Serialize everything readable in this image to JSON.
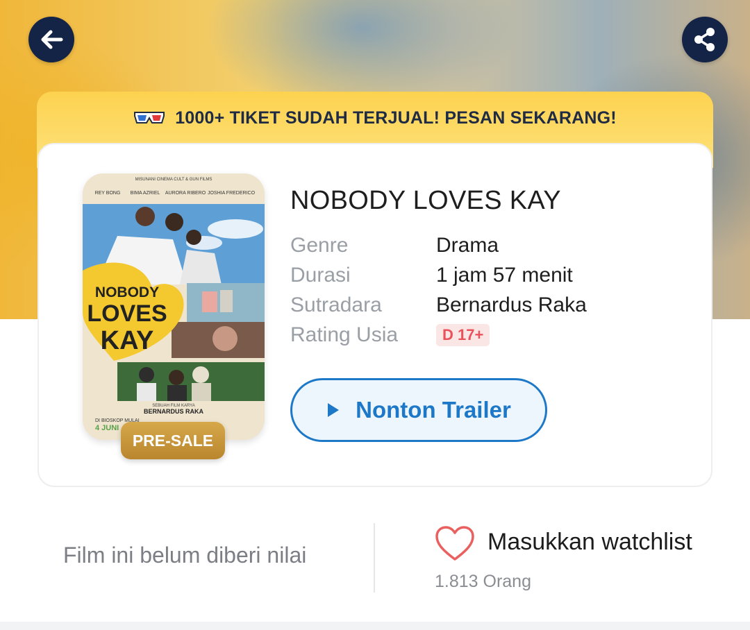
{
  "header": {
    "back_icon": "arrow-left-icon",
    "share_icon": "share-icon"
  },
  "banner": {
    "icon": "3d-glasses-icon",
    "text": "1000+ TIKET SUDAH TERJUAL! PESAN SEKARANG!"
  },
  "movie": {
    "title": "NOBODY LOVES KAY",
    "badge": "PRE-SALE",
    "poster": {
      "studio": "MISUNANI CINEMA CULT & GUN FILMS",
      "cast": [
        "REY BONG",
        "BIMA AZRIEL",
        "AURORA RIBERO",
        "JOSHIA FREDERICO"
      ],
      "title_line1": "NOBODY",
      "title_line2": "LOVES",
      "title_line3": "KAY",
      "credit": "SEBUAH FILM KARYA",
      "director": "BERNARDUS RAKA",
      "release_prefix": "DI BIOSKOP MULAI",
      "release_date": "4 JUNI"
    },
    "info": [
      {
        "label": "Genre",
        "value": "Drama"
      },
      {
        "label": "Durasi",
        "value": "1 jam 57 menit"
      },
      {
        "label": "Sutradara",
        "value": "Bernardus Raka"
      },
      {
        "label": "Rating Usia",
        "value": "D 17+"
      }
    ],
    "trailer_label": "Nonton Trailer"
  },
  "footer": {
    "rating_text": "Film ini belum diberi nilai",
    "watchlist_label": "Masukkan watchlist",
    "watchlist_count": "1.813 Orang"
  },
  "colors": {
    "banner": "#fdd24f",
    "nav_button": "#142447",
    "trailer_accent": "#1e78c8",
    "rating_badge_text": "#e9525a",
    "presale_gold": "#c6953a"
  }
}
